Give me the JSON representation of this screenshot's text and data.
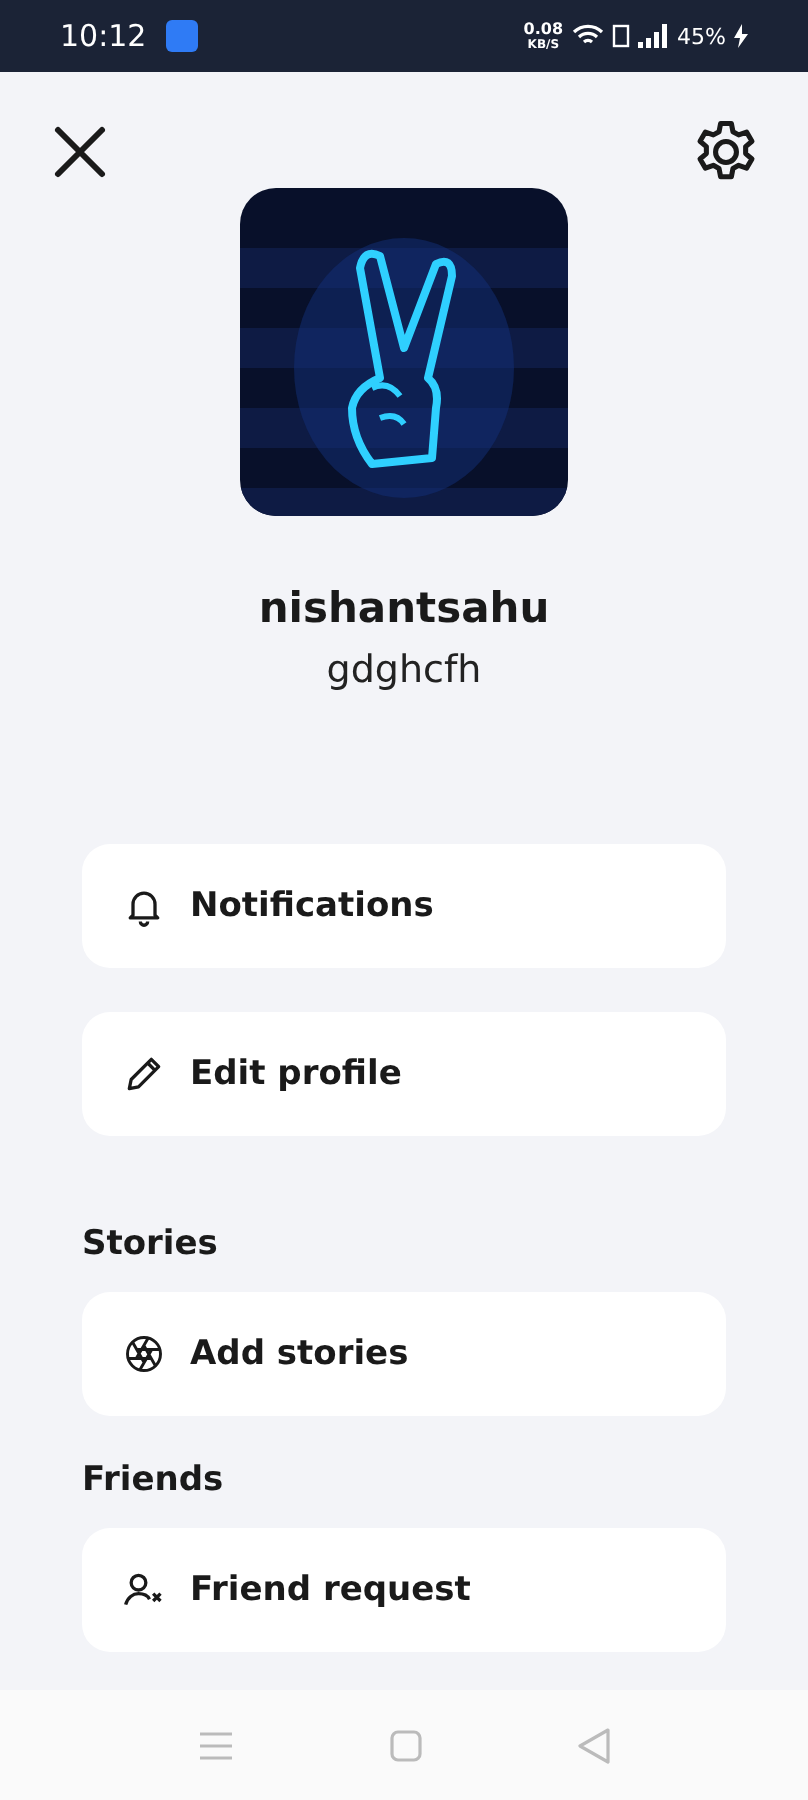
{
  "status_bar": {
    "time": "10:12",
    "net_speed": "0.08",
    "net_unit": "KB/S",
    "battery": "45%"
  },
  "profile": {
    "name": "nishantsahu",
    "username": "gdghcfh"
  },
  "sections": [
    {
      "items": [
        {
          "kind": "bell",
          "label": "Notifications"
        },
        {
          "kind": "pencil",
          "label": "Edit profile"
        }
      ]
    },
    {
      "title": "Stories",
      "items": [
        {
          "kind": "aperture",
          "label": "Add stories"
        }
      ]
    },
    {
      "title": "Friends",
      "items": [
        {
          "kind": "person",
          "label": "Friend request"
        }
      ]
    }
  ]
}
